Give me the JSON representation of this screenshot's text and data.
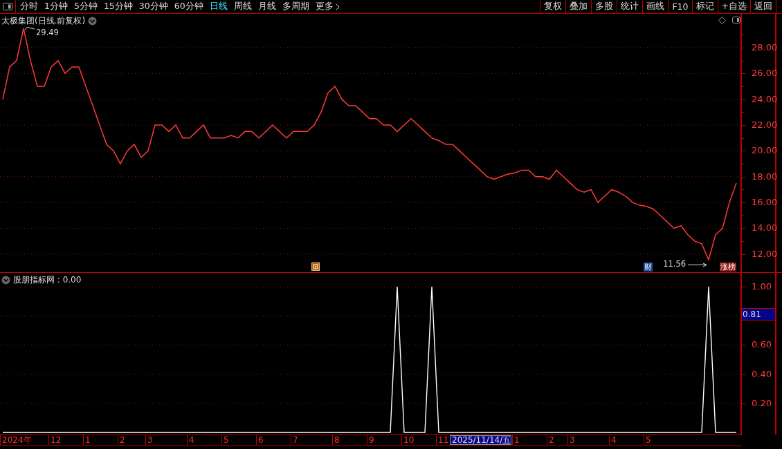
{
  "toolbar": {
    "periods": [
      {
        "label": "分时",
        "selected": false
      },
      {
        "label": "1分钟",
        "selected": false
      },
      {
        "label": "5分钟",
        "selected": false
      },
      {
        "label": "15分钟",
        "selected": false
      },
      {
        "label": "30分钟",
        "selected": false
      },
      {
        "label": "60分钟",
        "selected": false
      },
      {
        "label": "日线",
        "selected": true
      },
      {
        "label": "周线",
        "selected": false
      },
      {
        "label": "月线",
        "selected": false
      },
      {
        "label": "多周期",
        "selected": false
      },
      {
        "label": "更多",
        "selected": false
      }
    ],
    "actions": [
      "复权",
      "叠加",
      "多股",
      "统计",
      "画线",
      "F10",
      "标记",
      "+自选",
      "返回"
    ]
  },
  "price_panel": {
    "title": "太极集团(日线.前复权)",
    "high_label": "29.49",
    "low_label": "11.56",
    "markers": [
      {
        "kind": "icon"
      },
      {
        "kind": "label",
        "label": "财",
        "color": "#1d4f9a"
      },
      {
        "kind": "label",
        "label": "涨榜",
        "color": "#8e1b14"
      }
    ],
    "chart_data": {
      "type": "line",
      "ylim": [
        10.6,
        30.62
      ],
      "grid": true,
      "values": [
        24,
        26.5,
        27,
        29.49,
        27,
        25,
        25,
        26.5,
        27,
        26,
        26.5,
        26.5,
        25,
        23.5,
        22,
        20.5,
        20,
        19,
        20,
        20.5,
        19.5,
        20,
        22,
        22,
        21.5,
        22,
        21,
        21,
        21.5,
        22,
        21,
        21,
        21,
        21.2,
        21,
        21.5,
        21.5,
        21,
        21.5,
        22,
        21.5,
        21,
        21.5,
        21.5,
        21.5,
        22,
        23,
        24.5,
        25,
        24,
        23.5,
        23.5,
        23,
        22.5,
        22.5,
        22,
        22,
        21.5,
        22,
        22.5,
        22,
        21.5,
        21,
        20.8,
        20.5,
        20.5,
        20,
        19.5,
        19,
        18.5,
        18,
        17.8,
        18,
        18.2,
        18.3,
        18.5,
        18.5,
        18,
        18,
        17.8,
        18.5,
        18,
        17.5,
        17,
        16.8,
        17,
        16,
        16.5,
        17,
        16.8,
        16.5,
        16,
        15.8,
        15.7,
        15.5,
        15,
        14.5,
        14,
        14.2,
        13.5,
        13,
        12.8,
        11.56,
        13.5,
        14,
        16,
        17.5
      ],
      "yticks": [
        {
          "value": 12,
          "label": "12.00"
        },
        {
          "value": 14,
          "label": "14.00"
        },
        {
          "value": 16,
          "label": "16.00"
        },
        {
          "value": 18,
          "label": "18.00"
        },
        {
          "value": 20,
          "label": "20.00"
        },
        {
          "value": 22,
          "label": "22.00"
        },
        {
          "value": 24,
          "label": "24.00"
        },
        {
          "value": 26,
          "label": "26.00"
        },
        {
          "value": 28,
          "label": "28.00"
        }
      ]
    }
  },
  "indicator_panel": {
    "title": "股朋指标网 : 0.00",
    "cursor_value": "0.81",
    "chart_data": {
      "type": "line",
      "ylim": [
        -0.014,
        1.095
      ],
      "grid": true,
      "values": [
        0,
        0,
        0,
        0,
        0,
        0,
        0,
        0,
        0,
        0,
        0,
        0,
        0,
        0,
        0,
        0,
        0,
        0,
        0,
        0,
        0,
        0,
        0,
        0,
        0,
        0,
        0,
        0,
        0,
        0,
        0,
        0,
        0,
        0,
        0,
        0,
        0,
        0,
        0,
        0,
        0,
        0,
        0,
        0,
        0,
        0,
        0,
        0,
        0,
        0,
        0,
        0,
        0,
        0,
        0,
        0,
        0,
        1,
        0,
        0,
        0,
        0,
        1,
        0,
        0,
        0,
        0,
        0,
        0,
        0,
        0,
        0,
        0,
        0,
        0,
        0,
        0,
        0,
        0,
        0,
        0,
        0,
        0,
        0,
        0,
        0,
        0,
        0,
        0,
        0,
        0,
        0,
        0,
        0,
        0,
        0,
        0,
        0,
        0,
        0,
        0,
        0,
        1,
        0,
        0,
        0,
        0
      ],
      "yticks": [
        {
          "value": 0.2,
          "label": "0.20"
        },
        {
          "value": 0.4,
          "label": "0.40"
        },
        {
          "value": 0.6,
          "label": "0.60"
        },
        {
          "value": 1.0,
          "label": "1.00"
        }
      ]
    }
  },
  "date_axis": {
    "ticks": [
      {
        "label": "2024年",
        "selected": false
      },
      {
        "label": "12",
        "selected": false
      },
      {
        "label": "1",
        "selected": false
      },
      {
        "label": "2",
        "selected": false
      },
      {
        "label": "3",
        "selected": false
      },
      {
        "label": "4",
        "selected": false
      },
      {
        "label": "5",
        "selected": false
      },
      {
        "label": "6",
        "selected": false
      },
      {
        "label": "7",
        "selected": false
      },
      {
        "label": "8",
        "selected": false
      },
      {
        "label": "9",
        "selected": false
      },
      {
        "label": "10",
        "selected": false
      },
      {
        "label": "11",
        "selected": false
      },
      {
        "label": "2025/11/14/五",
        "selected": true
      },
      {
        "label": "1",
        "selected": false
      },
      {
        "label": "2",
        "selected": false
      },
      {
        "label": "3",
        "selected": false
      },
      {
        "label": "4",
        "selected": false
      },
      {
        "label": "5",
        "selected": false
      }
    ]
  }
}
